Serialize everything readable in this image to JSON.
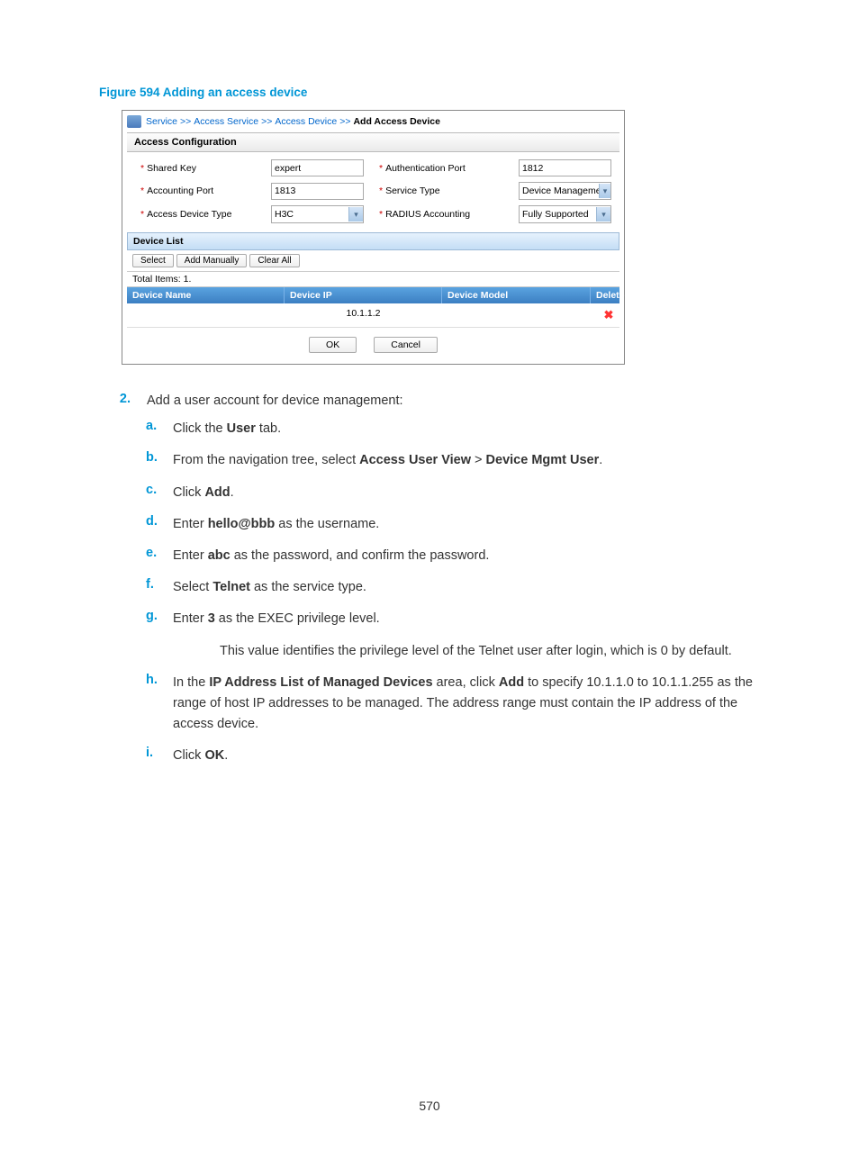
{
  "figure_title": "Figure 594 Adding an access device",
  "breadcrumb": {
    "service": "Service",
    "access_service": "Access Service",
    "access_device": "Access Device",
    "current": "Add Access Device"
  },
  "section_access_config": "Access Configuration",
  "form": {
    "shared_key_label": "Shared Key",
    "shared_key_value": "expert",
    "auth_port_label": "Authentication Port",
    "auth_port_value": "1812",
    "acct_port_label": "Accounting Port",
    "acct_port_value": "1813",
    "service_type_label": "Service Type",
    "service_type_value": "Device Management S",
    "access_device_type_label": "Access Device Type",
    "access_device_type_value": "H3C",
    "radius_acct_label": "RADIUS Accounting",
    "radius_acct_value": "Fully Supported"
  },
  "device_list_header": "Device List",
  "buttons": {
    "select": "Select",
    "add_manually": "Add Manually",
    "clear_all": "Clear All"
  },
  "total_items": "Total Items: 1.",
  "table": {
    "col_name": "Device Name",
    "col_ip": "Device IP",
    "col_model": "Device Model",
    "col_delete": "Delete",
    "row_ip": "10.1.1.2"
  },
  "dialog": {
    "ok": "OK",
    "cancel": "Cancel"
  },
  "step2": {
    "num": "2.",
    "text": "Add a user account for device management:"
  },
  "substeps": {
    "a": {
      "letter": "a.",
      "prefix": "Click the ",
      "bold": "User",
      "suffix": " tab."
    },
    "b": {
      "letter": "b.",
      "prefix": "From the navigation tree, select ",
      "bold1": "Access User View",
      "mid": " > ",
      "bold2": "Device Mgmt User",
      "suffix": "."
    },
    "c": {
      "letter": "c.",
      "prefix": "Click ",
      "bold": "Add",
      "suffix": "."
    },
    "d": {
      "letter": "d.",
      "prefix": "Enter ",
      "bold": "hello@bbb",
      "suffix": " as the username."
    },
    "e": {
      "letter": "e.",
      "prefix": "Enter ",
      "bold": "abc",
      "suffix": " as the password, and confirm the password."
    },
    "f": {
      "letter": "f.",
      "prefix": "Select ",
      "bold": "Telnet",
      "suffix": " as the service type."
    },
    "g": {
      "letter": "g.",
      "prefix": "Enter ",
      "bold": "3",
      "suffix": " as the EXEC privilege level."
    },
    "g_note": "This value identifies the privilege level of the Telnet user after login, which is 0 by default.",
    "h": {
      "letter": "h.",
      "prefix": "In the ",
      "bold1": "IP Address List of Managed Devices",
      "mid": " area, click ",
      "bold2": "Add",
      "suffix": " to specify 10.1.1.0 to 10.1.1.255 as the range of host IP addresses to be managed. The address range must contain the IP address of the access device."
    },
    "i": {
      "letter": "i.",
      "prefix": "Click ",
      "bold": "OK",
      "suffix": "."
    }
  },
  "page_number": "570"
}
